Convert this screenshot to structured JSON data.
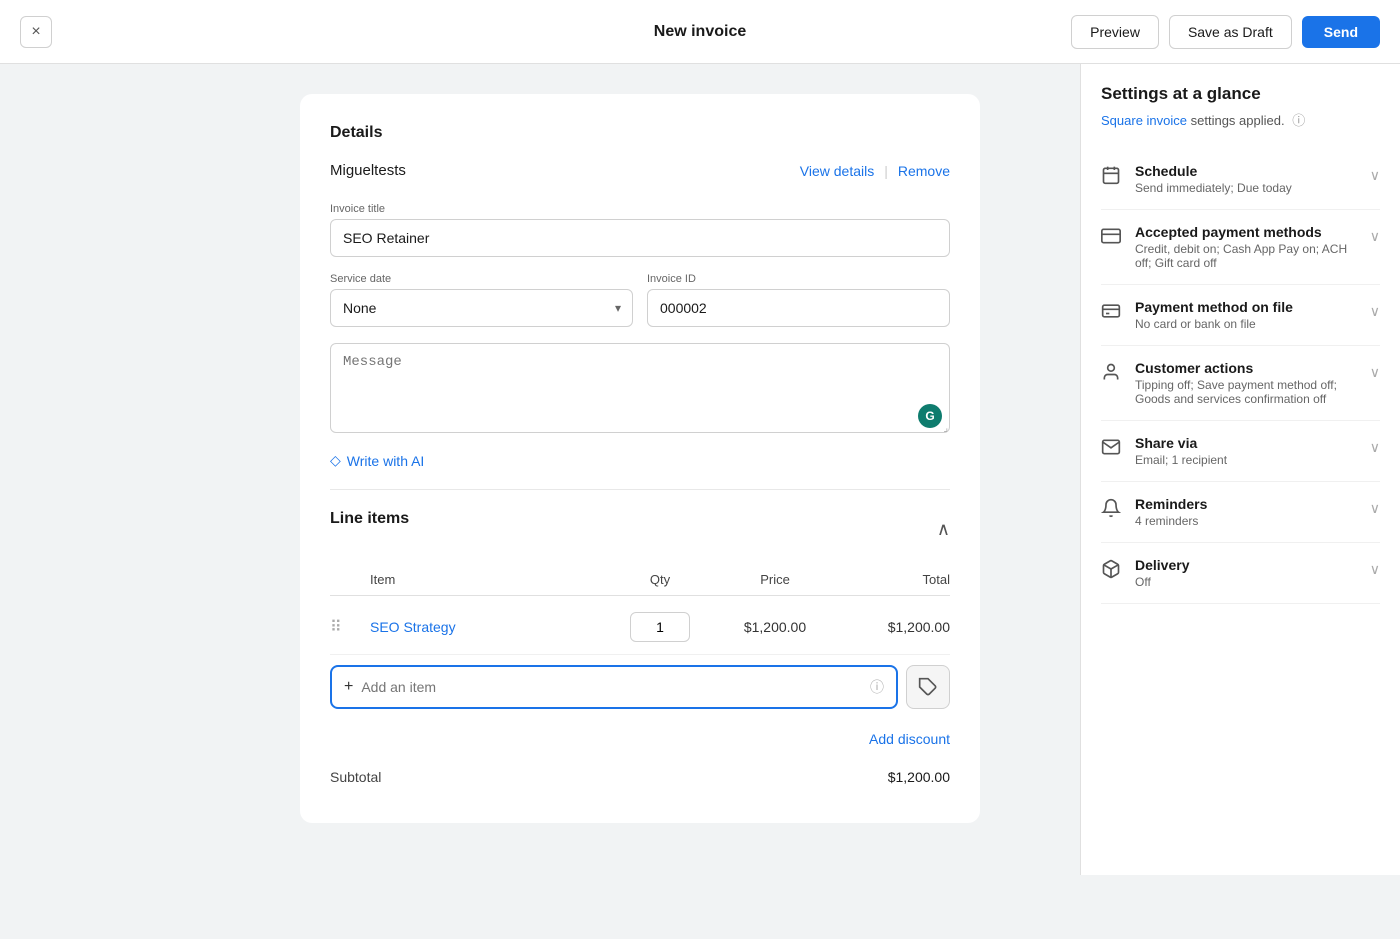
{
  "topbar": {
    "title": "New invoice",
    "close_label": "×",
    "preview_label": "Preview",
    "save_draft_label": "Save as Draft",
    "send_label": "Send"
  },
  "details": {
    "section_title": "Details",
    "customer_name": "Migueltests",
    "view_details_label": "View details",
    "remove_label": "Remove",
    "invoice_title_label": "Invoice title",
    "invoice_title_value": "SEO Retainer",
    "service_date_label": "Service date",
    "service_date_value": "None",
    "invoice_id_label": "Invoice ID",
    "invoice_id_value": "000002",
    "message_placeholder": "Message",
    "write_ai_label": "Write with AI"
  },
  "line_items": {
    "section_title": "Line items",
    "columns": {
      "item": "Item",
      "qty": "Qty",
      "price": "Price",
      "total": "Total"
    },
    "items": [
      {
        "name": "SEO Strategy",
        "qty": "1",
        "price": "$1,200.00",
        "total": "$1,200.00"
      }
    ],
    "add_item_placeholder": "Add an item",
    "add_discount_label": "Add discount",
    "subtotal_label": "Subtotal",
    "subtotal_value": "$1,200.00"
  },
  "settings": {
    "title": "Settings at a glance",
    "subtitle_prefix": "Square invoice",
    "subtitle_suffix": " settings applied.",
    "items": [
      {
        "id": "schedule",
        "icon": "calendar",
        "name": "Schedule",
        "detail": "Send immediately; Due today"
      },
      {
        "id": "payment-methods",
        "icon": "credit-card",
        "name": "Accepted payment methods",
        "detail": "Credit, debit on; Cash App Pay on; ACH off; Gift card off"
      },
      {
        "id": "payment-method-file",
        "icon": "payment-file",
        "name": "Payment method on file",
        "detail": "No card or bank on file"
      },
      {
        "id": "customer-actions",
        "icon": "person",
        "name": "Customer actions",
        "detail": "Tipping off; Save payment method off; Goods and services confirmation off"
      },
      {
        "id": "share-via",
        "icon": "email",
        "name": "Share via",
        "detail": "Email; 1 recipient"
      },
      {
        "id": "reminders",
        "icon": "bell",
        "name": "Reminders",
        "detail": "4 reminders"
      },
      {
        "id": "delivery",
        "icon": "box",
        "name": "Delivery",
        "detail": "Off"
      }
    ]
  }
}
